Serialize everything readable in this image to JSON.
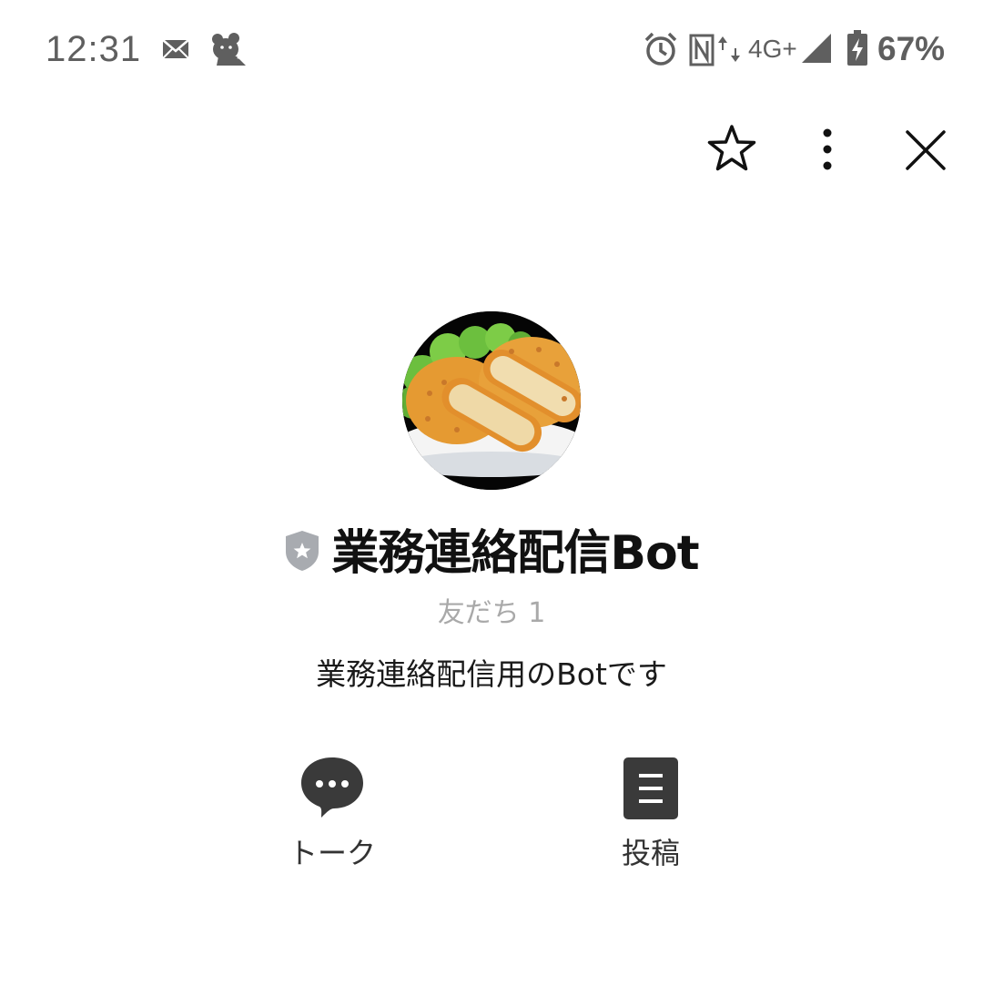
{
  "status_bar": {
    "time": "12:31",
    "network": "4G+",
    "battery": "67%",
    "icons": [
      "mail-icon",
      "bear-app-icon",
      "alarm-icon",
      "nfc-icon",
      "data-arrows-icon",
      "signal-icon",
      "battery-charging-icon"
    ]
  },
  "header": {
    "icons": [
      "star-icon",
      "more-vert-icon",
      "close-icon"
    ]
  },
  "profile": {
    "name": "業務連絡配信Bot",
    "friends": "友だち 1",
    "description": "業務連絡配信用のBotです",
    "badge_icon": "official-shield-icon",
    "avatar": "croquette-food-illustration"
  },
  "actions": [
    {
      "label": "トーク",
      "icon": "chat-bubble-icon"
    },
    {
      "label": "投稿",
      "icon": "post-document-icon"
    }
  ],
  "colors": {
    "status_text": "#5f5f5f",
    "muted_text": "#a9a9a9",
    "action_icon": "#3a3a3a",
    "shield": "#a8abb0"
  }
}
